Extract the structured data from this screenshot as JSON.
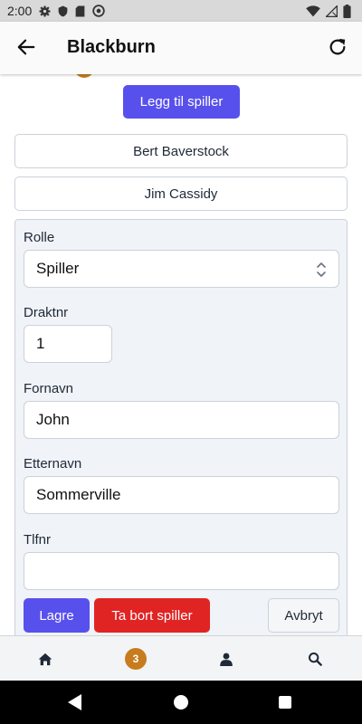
{
  "status_bar": {
    "time": "2:00",
    "icons": [
      "gear-icon",
      "shield-icon",
      "sd-card-icon",
      "at-sign-icon",
      "wifi-icon",
      "no-sim-icon",
      "battery-icon"
    ]
  },
  "app_bar": {
    "title": "Blackburn",
    "icons": [
      "back-arrow-icon",
      "refresh-icon"
    ]
  },
  "main": {
    "add_player_label": "Legg til spiller",
    "players": [
      {
        "name": "Bert Baverstock"
      },
      {
        "name": "Jim Cassidy"
      }
    ],
    "form": {
      "role": {
        "label": "Rolle",
        "value": "Spiller"
      },
      "jersey": {
        "label": "Draktnr",
        "value": "1"
      },
      "first_name": {
        "label": "Fornavn",
        "value": "John"
      },
      "last_name": {
        "label": "Etternavn",
        "value": "Sommerville"
      },
      "phone": {
        "label": "Tlfnr",
        "value": ""
      },
      "save_label": "Lagre",
      "remove_label": "Ta bort spiller",
      "cancel_label": "Avbryt"
    }
  },
  "bottom_nav": {
    "items": [
      "home-icon",
      "notifications-badge",
      "user-icon",
      "search-icon"
    ],
    "badge_count": "3"
  },
  "colors": {
    "primary": "#5850ec",
    "danger": "#e02424",
    "badge": "#c77c1d",
    "form_bg": "#f0f3f7"
  }
}
